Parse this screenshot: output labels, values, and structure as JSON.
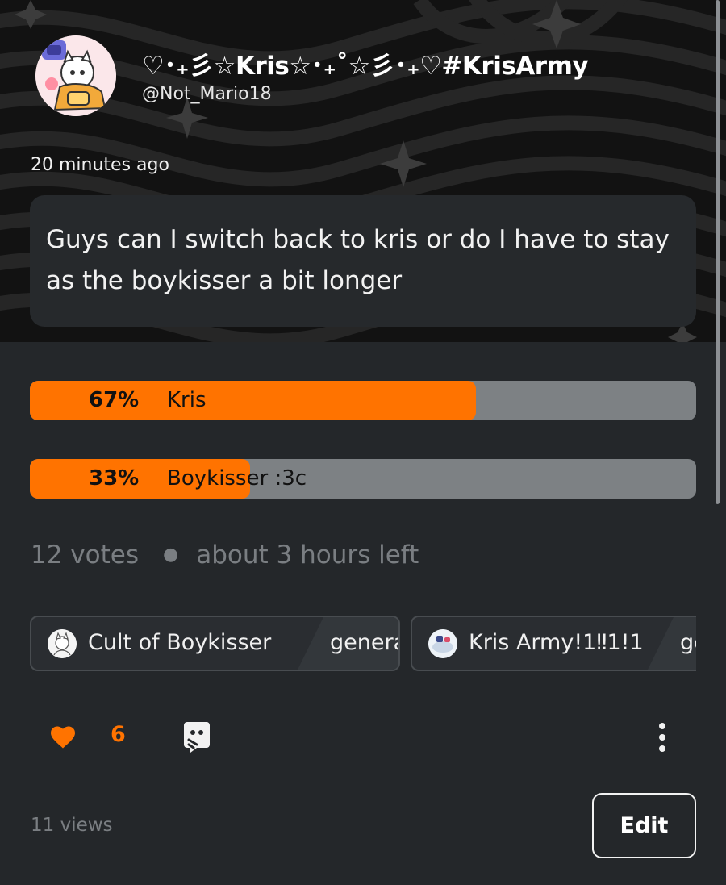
{
  "author": {
    "display_name": "♡･₊彡☆Kris☆･₊˚☆彡･₊♡#KrisArmy",
    "handle": "@Not_Mario18"
  },
  "post": {
    "timestamp": "20 minutes ago",
    "text": "Guys can I switch back to kris or do I have to stay as the boykisser a bit longer"
  },
  "poll": {
    "options": [
      {
        "percent_label": "67%",
        "label": "Kris",
        "share": 0.67
      },
      {
        "percent_label": "33%",
        "label": "Boykisser :3c",
        "share": 0.33
      }
    ],
    "votes": "12 votes",
    "time_left": "about 3 hours left"
  },
  "communities": [
    {
      "name": "Cult of Boykisser",
      "channel": "general"
    },
    {
      "name": "Kris Army!1‼1!1",
      "channel": "general"
    }
  ],
  "actions": {
    "like_count": "6",
    "icons": [
      "heart-icon",
      "comment-icon",
      "more-options-icon"
    ]
  },
  "footer": {
    "views": "11 views",
    "edit_label": "Edit"
  },
  "colors": {
    "accent": "#ff7300",
    "background": "#24272a",
    "poll_track": "#7d8184",
    "muted_text": "#7a7e82"
  }
}
